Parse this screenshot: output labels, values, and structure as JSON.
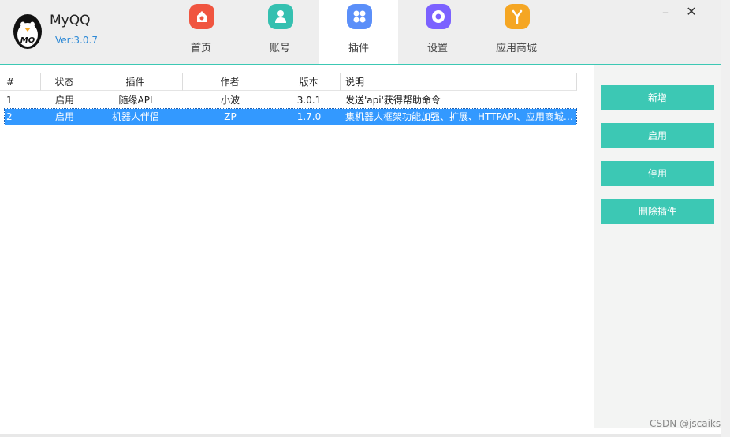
{
  "app": {
    "name": "MyQQ",
    "version": "Ver:3.0.7",
    "logo_text": "MQ"
  },
  "tabs": [
    {
      "label": "首页",
      "icon": "home-icon",
      "color": "#f05540"
    },
    {
      "label": "账号",
      "icon": "user-icon",
      "color": "#35c0b0"
    },
    {
      "label": "插件",
      "icon": "plugin-grid-icon",
      "color": "#5b8ff9"
    },
    {
      "label": "设置",
      "icon": "settings-icon",
      "color": "#7b61ff"
    },
    {
      "label": "应用商城",
      "icon": "store-icon",
      "color": "#f5a623"
    }
  ],
  "active_tab": "插件",
  "window": {
    "minimize": "–",
    "close": "✕"
  },
  "table": {
    "headers": [
      "#",
      "状态",
      "插件",
      "作者",
      "版本",
      "说明"
    ],
    "rows": [
      {
        "no": "1",
        "status": "启用",
        "plugin": "随缘API",
        "author": "小波",
        "version": "3.0.1",
        "desc": "发送'api'获得帮助命令",
        "selected": false
      },
      {
        "no": "2",
        "status": "启用",
        "plugin": "机器人伴侣",
        "author": "ZP",
        "version": "1.7.0",
        "desc": "集机器人框架功能加强、扩展、HTTPAPI、应用商城…",
        "selected": true
      }
    ]
  },
  "actions": {
    "add": "新增",
    "enable": "启用",
    "disable": "停用",
    "delete": "删除插件"
  },
  "watermark": "CSDN @jscaiks",
  "colors": {
    "accent": "#3cc8b4",
    "selection": "#3399ff",
    "version": "#2d89d6"
  }
}
